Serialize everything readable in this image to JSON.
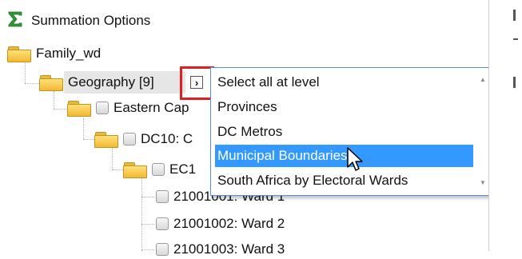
{
  "tree": {
    "summation_label": "Summation Options",
    "family_label": "Family_wd",
    "geography_label": "Geography [9]",
    "expand_glyph": "›",
    "nodes": [
      {
        "label": "Eastern Cap"
      },
      {
        "label": "DC10: C"
      },
      {
        "label": "EC1"
      },
      {
        "label": "21001001: Ward 1"
      },
      {
        "label": "21001002: Ward 2"
      },
      {
        "label": "21001003: Ward 3"
      }
    ]
  },
  "dropdown": {
    "items": [
      {
        "label": "Select all at level"
      },
      {
        "label": "Provinces"
      },
      {
        "label": "DC Metros"
      },
      {
        "label": "Municipal Boundaries"
      },
      {
        "label": "South Africa by Electoral Wards"
      }
    ],
    "selected_index": 3
  },
  "icons": {
    "summation": "sigma-icon",
    "folder": "folder-icon",
    "checkbox": "checkbox-icon",
    "expand": "chevron-right-icon",
    "cursor": "mouse-pointer-icon"
  },
  "colors": {
    "sigma_green": "#2e9b3a",
    "selection_blue": "#3399ff",
    "highlight_red": "#e02020",
    "dropdown_border": "#5a8fd6"
  }
}
